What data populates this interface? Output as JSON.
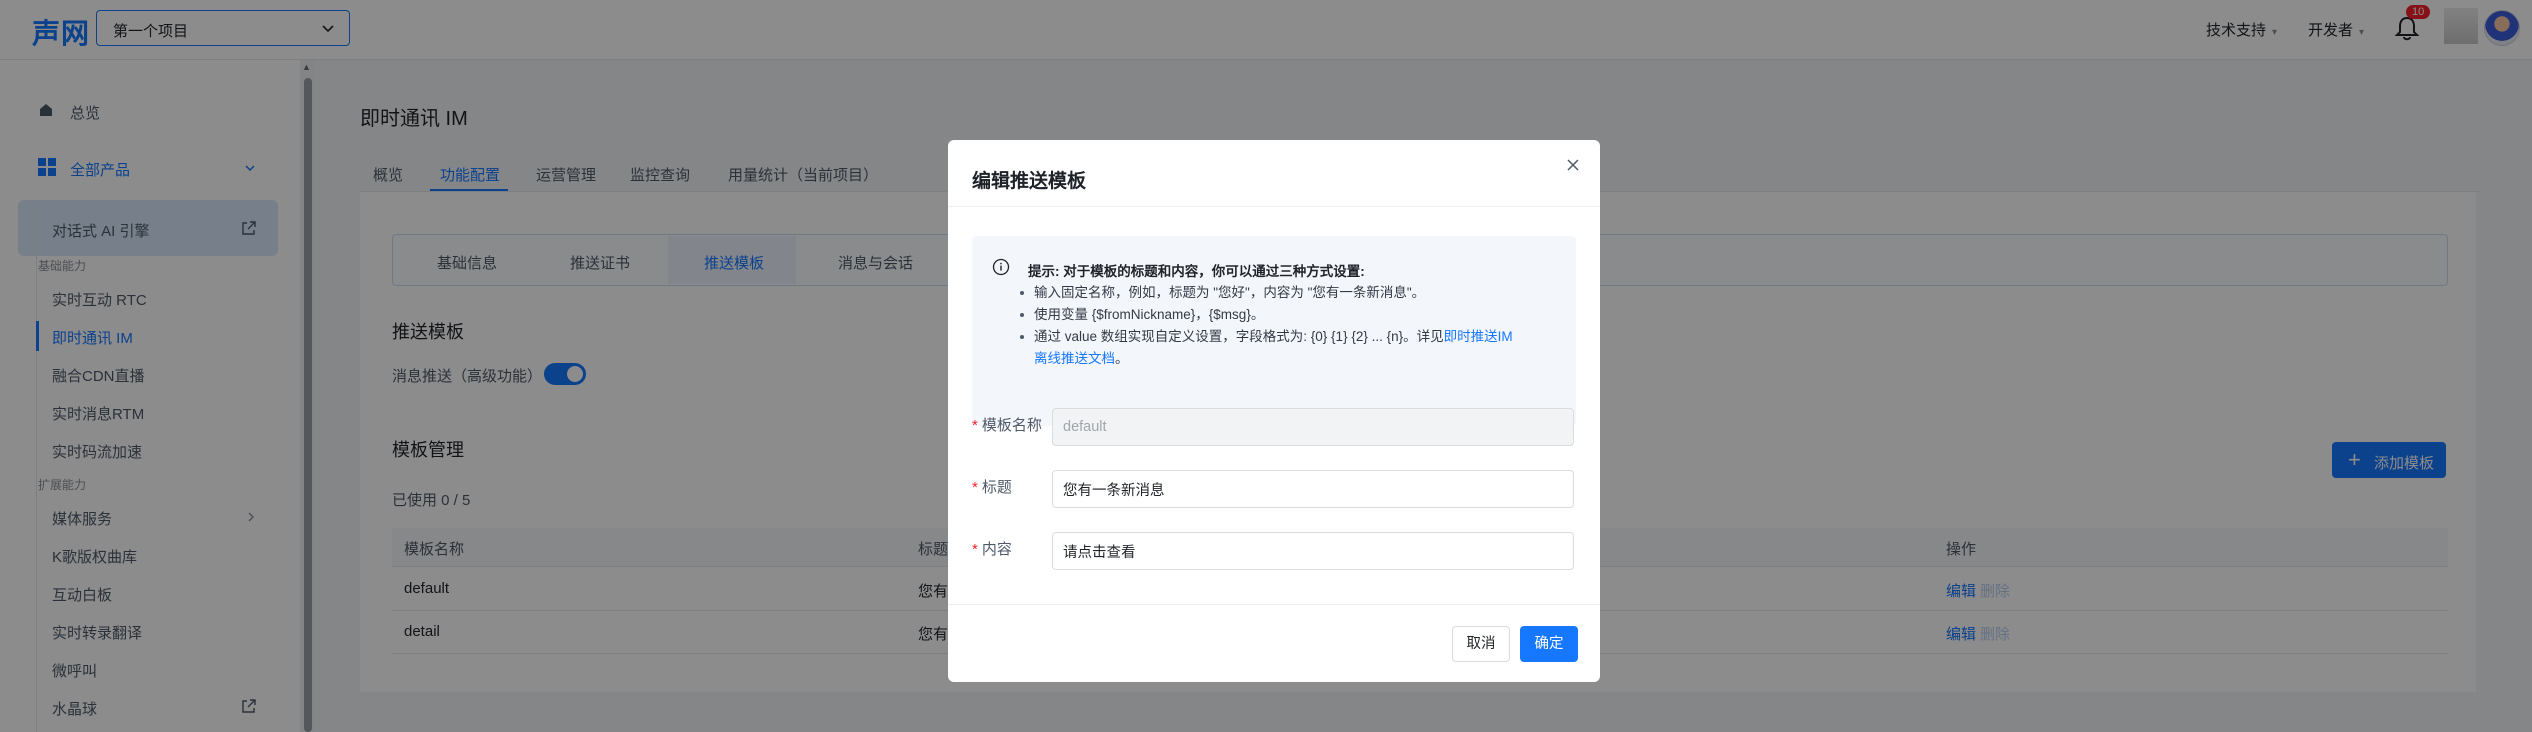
{
  "header": {
    "logo": "声网",
    "project": "第一个项目",
    "nav": [
      "技术支持",
      "开发者"
    ],
    "notification_count": "10"
  },
  "sidebar": {
    "overview": "总览",
    "all_products": "全部产品",
    "conversational_ai": "对话式 AI 引擎",
    "group_basic": "基础能力",
    "basic_items": [
      "实时互动 RTC",
      "即时通讯 IM",
      "融合CDN直播",
      "实时消息RTM",
      "实时码流加速"
    ],
    "group_ext": "扩展能力",
    "ext_items": [
      "媒体服务",
      "K歌版权曲库",
      "互动白板",
      "实时转录翻译",
      "微呼叫",
      "水晶球"
    ]
  },
  "page": {
    "title": "即时通讯 IM",
    "tabs": [
      "概览",
      "功能配置",
      "运营管理",
      "监控查询",
      "用量统计（当前项目）"
    ],
    "subtabs": [
      "基础信息",
      "推送证书",
      "推送模板",
      "消息与会话"
    ],
    "push_section_title": "推送模板",
    "push_toggle_label": "消息推送（高级功能）",
    "manage_title": "模板管理",
    "usage": "已使用 0 / 5",
    "add_button": "添加模板",
    "table": {
      "columns": [
        "模板名称",
        "标题",
        "操作"
      ],
      "rows": [
        {
          "name": "default",
          "title_partial": "您有",
          "edit": "编辑",
          "delete": "删除"
        },
        {
          "name": "detail",
          "title_partial": "您有",
          "edit": "编辑",
          "delete": "删除"
        }
      ]
    }
  },
  "modal": {
    "title": "编辑推送模板",
    "tip_head": "提示: 对于模板的标题和内容，你可以通过三种方式设置:",
    "tip_1": "输入固定名称，例如，标题为 \"您好\"，内容为 \"您有一条新消息\"。",
    "tip_2": "使用变量 {$fromNickname}，{$msg}。",
    "tip_3_text": "通过 value 数组实现自定义设置，字段格式为: {0} {1} {2} ... {n}。详见",
    "tip_3_link_a": "即时推送IM",
    "tip_3_link_b": "离线推送文档",
    "tip_3_end": "。",
    "fields": {
      "name_label": "模板名称",
      "name_value": "default",
      "title_label": "标题",
      "title_value": "您有一条新消息",
      "content_label": "内容",
      "content_value": "请点击查看"
    },
    "cancel": "取消",
    "confirm": "确定"
  }
}
